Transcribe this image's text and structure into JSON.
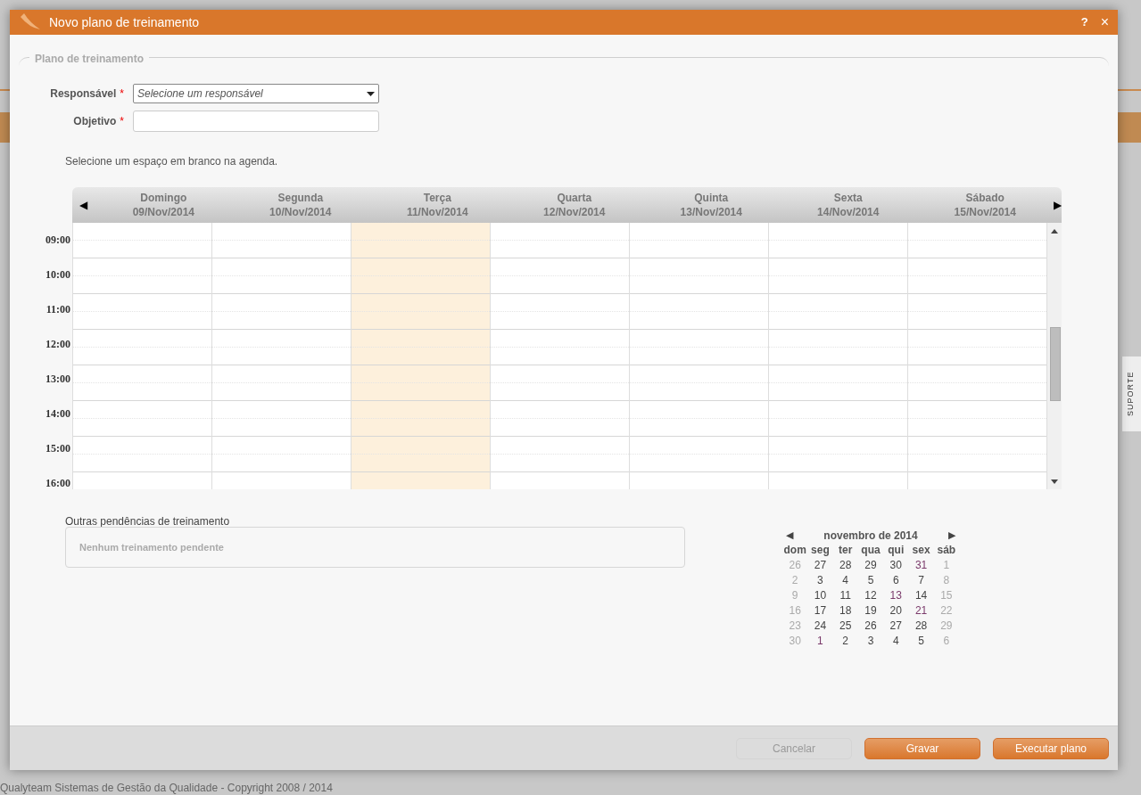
{
  "background": {
    "footer": "Qualyteam Sistemas de Gestão da Qualidade - Copyright 2008 / 2014",
    "support_tab": "SUPORTE"
  },
  "dialog": {
    "title": "Novo plano de treinamento",
    "help": "?",
    "close": "×"
  },
  "fieldset": {
    "legend": "Plano de treinamento"
  },
  "form": [
    {
      "kind": "select",
      "label": "Responsável",
      "required": true,
      "placeholder": "Selecione um responsável"
    },
    {
      "kind": "text",
      "label": "Objetivo",
      "required": true
    }
  ],
  "required_mark": "*",
  "hint": "Selecione um espaço em branco na agenda.",
  "agenda": {
    "prev": "◀",
    "next": "▶",
    "days": [
      {
        "name": "Domingo",
        "date": "09/Nov/2014",
        "highlighted": false
      },
      {
        "name": "Segunda",
        "date": "10/Nov/2014",
        "highlighted": false
      },
      {
        "name": "Terça",
        "date": "11/Nov/2014",
        "highlighted": true
      },
      {
        "name": "Quarta",
        "date": "12/Nov/2014",
        "highlighted": false
      },
      {
        "name": "Quinta",
        "date": "13/Nov/2014",
        "highlighted": false
      },
      {
        "name": "Sexta",
        "date": "14/Nov/2014",
        "highlighted": false
      },
      {
        "name": "Sábado",
        "date": "15/Nov/2014",
        "highlighted": false
      }
    ],
    "hours": [
      "09:00",
      "10:00",
      "11:00",
      "12:00",
      "13:00",
      "14:00",
      "15:00",
      "16:00"
    ]
  },
  "pending": {
    "label": "Outras pendências de treinamento",
    "empty": "Nenhum treinamento pendente"
  },
  "mini_calendar": {
    "prev": "◀",
    "next": "▶",
    "title": "novembro de 2014",
    "weekdays": [
      "dom",
      "seg",
      "ter",
      "qua",
      "qui",
      "sex",
      "sáb"
    ],
    "weeks": [
      [
        {
          "day": "26",
          "kind": "weekend"
        },
        {
          "day": "27",
          "kind": "weekday"
        },
        {
          "day": "28",
          "kind": "weekday"
        },
        {
          "day": "29",
          "kind": "weekday"
        },
        {
          "day": "30",
          "kind": "weekday"
        },
        {
          "day": "31",
          "kind": "marked"
        },
        {
          "day": "1",
          "kind": "weekend"
        }
      ],
      [
        {
          "day": "2",
          "kind": "weekend"
        },
        {
          "day": "3",
          "kind": "weekday"
        },
        {
          "day": "4",
          "kind": "weekday"
        },
        {
          "day": "5",
          "kind": "weekday"
        },
        {
          "day": "6",
          "kind": "weekday"
        },
        {
          "day": "7",
          "kind": "weekday"
        },
        {
          "day": "8",
          "kind": "weekend"
        }
      ],
      [
        {
          "day": "9",
          "kind": "weekend"
        },
        {
          "day": "10",
          "kind": "weekday"
        },
        {
          "day": "11",
          "kind": "weekday"
        },
        {
          "day": "12",
          "kind": "weekday"
        },
        {
          "day": "13",
          "kind": "marked"
        },
        {
          "day": "14",
          "kind": "weekday"
        },
        {
          "day": "15",
          "kind": "weekend"
        }
      ],
      [
        {
          "day": "16",
          "kind": "weekend"
        },
        {
          "day": "17",
          "kind": "weekday"
        },
        {
          "day": "18",
          "kind": "weekday"
        },
        {
          "day": "19",
          "kind": "weekday"
        },
        {
          "day": "20",
          "kind": "weekday"
        },
        {
          "day": "21",
          "kind": "marked"
        },
        {
          "day": "22",
          "kind": "weekend"
        }
      ],
      [
        {
          "day": "23",
          "kind": "weekend"
        },
        {
          "day": "24",
          "kind": "weekday"
        },
        {
          "day": "25",
          "kind": "weekday"
        },
        {
          "day": "26",
          "kind": "weekday"
        },
        {
          "day": "27",
          "kind": "weekday"
        },
        {
          "day": "28",
          "kind": "weekday"
        },
        {
          "day": "29",
          "kind": "weekend"
        }
      ],
      [
        {
          "day": "30",
          "kind": "weekend"
        },
        {
          "day": "1",
          "kind": "marked"
        },
        {
          "day": "2",
          "kind": "weekday"
        },
        {
          "day": "3",
          "kind": "weekday"
        },
        {
          "day": "4",
          "kind": "weekday"
        },
        {
          "day": "5",
          "kind": "weekday"
        },
        {
          "day": "6",
          "kind": "weekend"
        }
      ]
    ]
  },
  "buttons": [
    {
      "label": "Cancelar",
      "kind": "secondary",
      "disabled": true
    },
    {
      "label": "Gravar",
      "kind": "primary",
      "disabled": false
    },
    {
      "label": "Executar plano",
      "kind": "primary",
      "disabled": false
    }
  ]
}
